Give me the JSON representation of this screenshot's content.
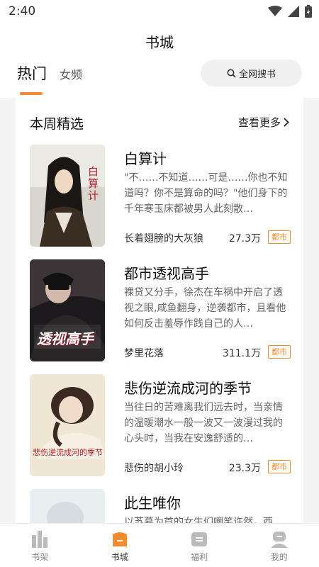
{
  "status": {
    "time": "2:40"
  },
  "header": {
    "title": "书城"
  },
  "tabs": [
    {
      "label": "热门",
      "active": true
    },
    {
      "label": "女频",
      "active": false
    }
  ],
  "search": {
    "label": "全网搜书"
  },
  "section": {
    "title": "本周精选",
    "more": "查看更多"
  },
  "books": [
    {
      "title": "白算计",
      "desc": "\"不……不知道……可是……你也不知道吗？你不是算命的吗？\"他们身下的千年寒玉床都被男人此刻散…",
      "author": "长着翅膀的大灰狼",
      "count": "27.3万",
      "tag": "都市",
      "cover_text": "白算计"
    },
    {
      "title": "都市透视高手",
      "desc": "裸贷又分手，徐杰在车祸中开启了透视之眼,咸鱼翻身，逆袭都市，且看他如何反击羞辱作践自己的人…",
      "author": "梦里花落",
      "count": "311.1万",
      "tag": "都市",
      "cover_text": "透视高手"
    },
    {
      "title": "悲伤逆流成河的季节",
      "desc": "当往日的苦难离我们远去时，当亲情的温暖潮水一般一波又一波漫过我的心头时，当我在安逸舒适的…",
      "author": "悲伤的胡小玲",
      "count": "23.3万",
      "tag": "都市",
      "cover_text": "悲伤逆流成河的季节"
    },
    {
      "title": "此生唯你",
      "desc": "以苏慕为首的女生们嘲笑许然，西",
      "author": "",
      "count": "",
      "tag": "",
      "cover_text": ""
    }
  ],
  "nav": [
    {
      "label": "书架",
      "icon": "bookshelf-icon",
      "active": false
    },
    {
      "label": "书城",
      "icon": "bookstore-icon",
      "active": true
    },
    {
      "label": "福利",
      "icon": "gift-icon",
      "active": false
    },
    {
      "label": "我的",
      "icon": "profile-icon",
      "active": false
    }
  ],
  "colors": {
    "accent": "#f28a2e"
  }
}
